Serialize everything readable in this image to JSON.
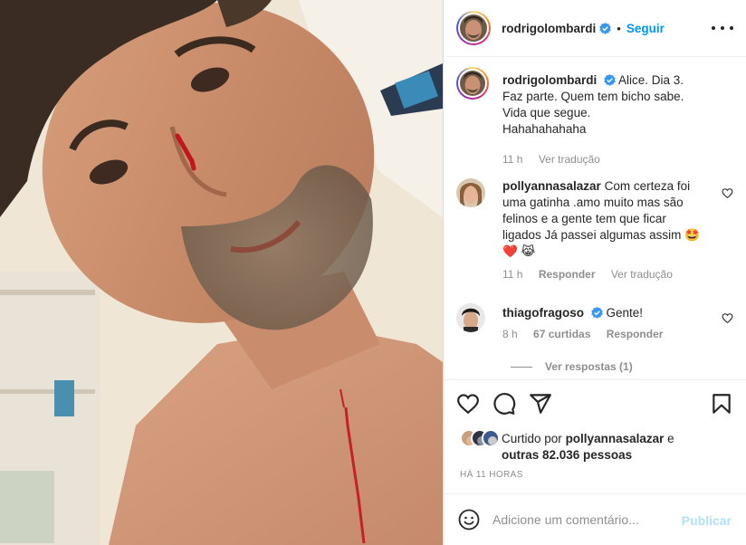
{
  "post": {
    "author": "rodrigolombardi",
    "follow_label": "Seguir",
    "dot": "•",
    "caption_lines": [
      "Alice. Dia 3.",
      "Faz parte. Quem tem bicho sabe.",
      "Vida que segue.",
      "Hahahahahaha"
    ],
    "caption_time": "11 h",
    "caption_translate": "Ver tradução"
  },
  "comments": [
    {
      "user": "pollyannasalazar",
      "lines": [
        "Com certeza foi",
        "uma gatinha .amo muito mas são",
        "felinos e a gente tem que ficar",
        "ligados Já passei algumas assim 🤩",
        "❤️ 😹"
      ],
      "time": "11 h",
      "reply": "Responder",
      "translate": "Ver tradução"
    },
    {
      "user": "thiagofragoso",
      "text": "Gente!",
      "time": "8 h",
      "likes": "67 curtidas",
      "reply": "Responder"
    }
  ],
  "view_replies": "Ver respostas (1)",
  "likes": {
    "prefix": "Curtido por",
    "user": "pollyannasalazar",
    "joiner": "e",
    "others": "outras 82.036 pessoas"
  },
  "timestamp": "HÁ 11 HORAS",
  "add_comment": {
    "placeholder": "Adicione um comentário...",
    "publish": "Publicar"
  },
  "icons": {
    "header_more": "more-horizontal-icon",
    "verified": "verified-badge-icon",
    "like": "heart-icon",
    "comment": "comment-bubble-icon",
    "share": "paper-plane-icon",
    "save": "bookmark-icon",
    "emoji": "emoji-smile-icon"
  },
  "colors": {
    "accent": "#0095f6",
    "publish_disabled": "#b2dffc",
    "muted": "#8e8e8e",
    "text": "#262626",
    "border": "#efefef"
  }
}
